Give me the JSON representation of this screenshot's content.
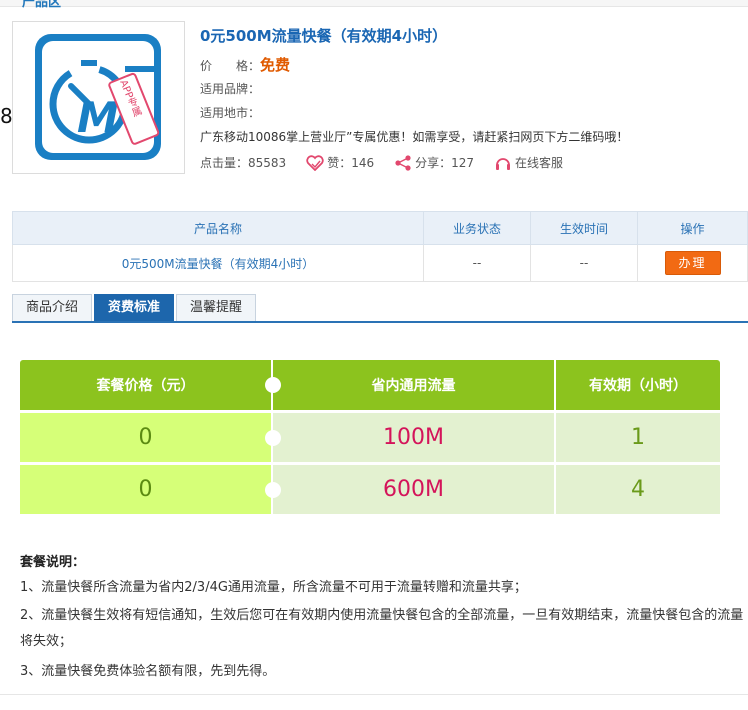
{
  "header": {
    "crumb": "产品区"
  },
  "side": {
    "glyph": "8"
  },
  "product": {
    "title": "0元500M流量快餐（有效期4小时）",
    "price_label": "价　　格：",
    "price_value": "免费",
    "brand_label": "适用品牌：",
    "brand_value": "",
    "region_label": "适用地市：",
    "region_value": "",
    "promo": "广东移动10086掌上营业厅”专属优惠！如需享受，请赶紧扫网页下方二维码哦！",
    "image_badge": "APP专属",
    "image_letter": "M",
    "stats": {
      "views_label": "点击量：",
      "views": "85583",
      "likes_label": "赞：",
      "likes": "146",
      "shares_label": "分享：",
      "shares": "127",
      "service": "在线客服"
    }
  },
  "biz_table": {
    "headers": [
      "产品名称",
      "业务状态",
      "生效时间",
      "操作"
    ],
    "row": {
      "name": "0元500M流量快餐（有效期4小时）",
      "status": "--",
      "effective": "--",
      "action": "办理"
    }
  },
  "tabs": [
    {
      "label": "商品介绍"
    },
    {
      "label": "资费标准",
      "active": true
    },
    {
      "label": "温馨提醒"
    }
  ],
  "fee_table": {
    "headers": [
      "套餐价格（元）",
      "省内通用流量",
      "有效期（小时）"
    ],
    "rows": [
      {
        "price": "0",
        "data": "100M",
        "validity": "1"
      },
      {
        "price": "0",
        "data": "600M",
        "validity": "4"
      }
    ]
  },
  "notes": {
    "title": "套餐说明：",
    "items": [
      "1、流量快餐所含流量为省内2/3/4G通用流量，所含流量不可用于流量转赠和流量共享；",
      "2、流量快餐生效将有短信通知，生效后您可在有效期内使用流量快餐包含的全部流量，一旦有效期结束，流量快餐包含的流量将失效；",
      "3、流量快餐免费体验名额有限，先到先得。"
    ]
  },
  "colors": {
    "accent_blue": "#1d66ac",
    "header_green": "#8cc31e",
    "price_orange": "#e05a00",
    "button_orange": "#f26a13",
    "data_pink": "#d4145a"
  }
}
